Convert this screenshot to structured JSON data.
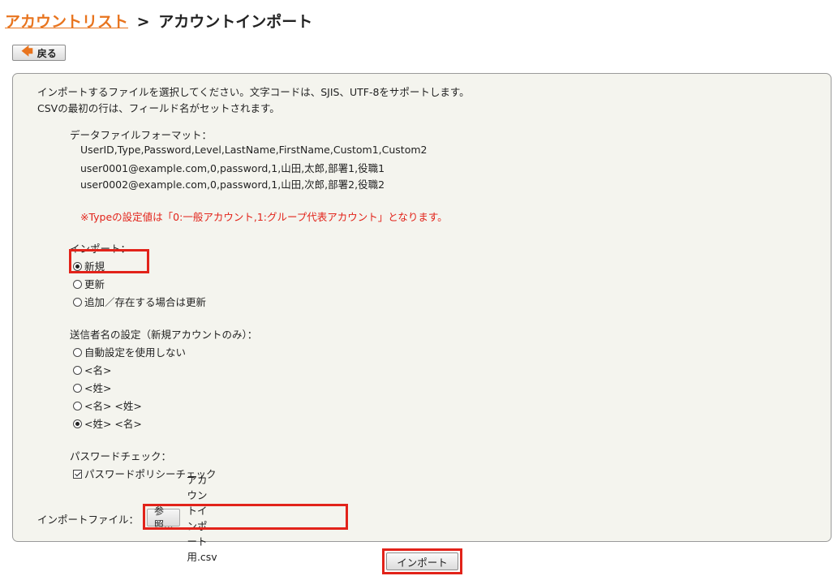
{
  "breadcrumb": {
    "parent": "アカウントリスト",
    "separator": ">",
    "current": "アカウントインポート"
  },
  "back_button": {
    "label": "戻る",
    "icon": "arrow-left-icon"
  },
  "intro": {
    "line1": "インポートするファイルを選択してください。文字コードは、SJIS、UTF-8をサポートします。",
    "line2": "CSVの最初の行は、フィールド名がセットされます。"
  },
  "format": {
    "title": "データファイルフォーマット：",
    "lines": [
      "UserID,Type,Password,Level,LastName,FirstName,Custom1,Custom2",
      "user0001@example.com,0,password,1,山田,太郎,部署1,役職1",
      "user0002@example.com,0,password,1,山田,次郎,部署2,役職2"
    ],
    "note": "※Typeの設定値は「0:一般アカウント,1:グループ代表アカウント」となります。"
  },
  "import_mode": {
    "title": "インポート：",
    "options": [
      "新規",
      "更新",
      "追加／存在する場合は更新"
    ],
    "selected_index": 0
  },
  "sender_name": {
    "title": "送信者名の設定（新規アカウントのみ）：",
    "options": [
      "自動設定を使用しない",
      "<名>",
      "<姓>",
      "<名> <姓>",
      "<姓> <名>"
    ],
    "selected_index": 4
  },
  "password_check": {
    "title": "パスワードチェック：",
    "checkbox_label": "パスワードポリシーチェック",
    "checked": true
  },
  "file": {
    "label": "インポートファイル：",
    "browse_label": "参照...",
    "file_name": "アカウントインポート用.csv"
  },
  "import_button": {
    "label": "インポート"
  },
  "colors": {
    "accent": "#e8741e",
    "highlight": "#e2231a",
    "panel_bg": "#f4f4ee"
  }
}
